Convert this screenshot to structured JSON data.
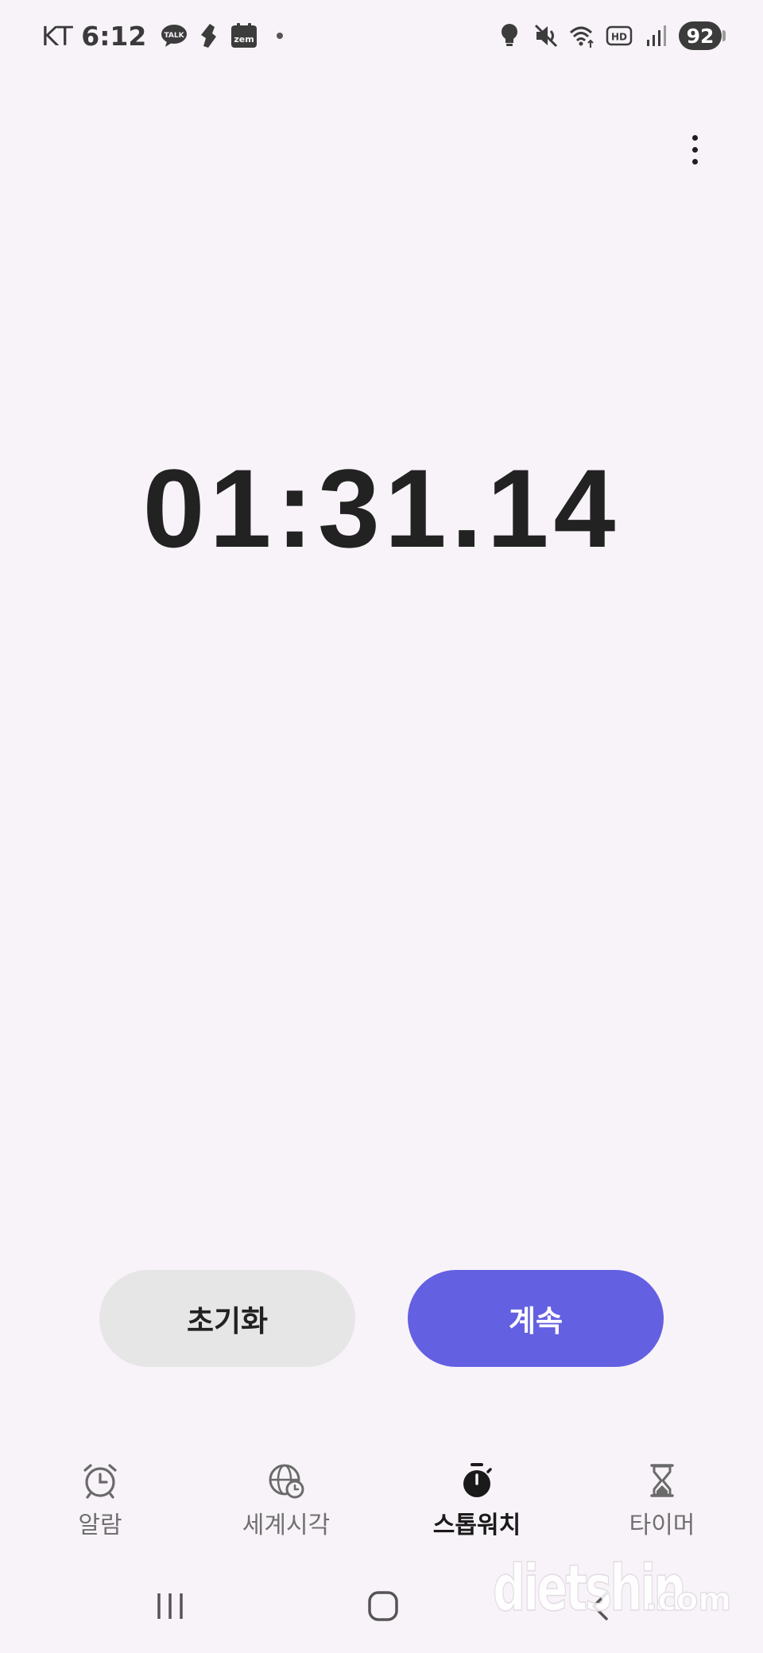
{
  "status_bar": {
    "carrier": "KT",
    "time": "6:12",
    "battery": "92",
    "notification_icons": [
      "kakaotalk-icon",
      "app-notification-icon",
      "zem-icon"
    ],
    "system_icons": [
      "bulb-icon",
      "mute-icon",
      "wifi-icon",
      "hd-voice-icon",
      "signal-icon"
    ]
  },
  "stopwatch": {
    "elapsed": "01:31.14"
  },
  "controls": {
    "reset_label": "초기화",
    "continue_label": "계속",
    "reset_color": "#e6e6e6",
    "continue_color": "#6460e2"
  },
  "tabs": [
    {
      "label": "알람",
      "icon": "alarm-clock-icon",
      "active": false
    },
    {
      "label": "세계시각",
      "icon": "globe-clock-icon",
      "active": false
    },
    {
      "label": "스톱워치",
      "icon": "stopwatch-icon",
      "active": true
    },
    {
      "label": "타이머",
      "icon": "hourglass-icon",
      "active": false
    }
  ],
  "nav_bar": {
    "recents_icon": "recents-icon",
    "home_icon": "home-icon",
    "back_icon": "back-icon"
  },
  "theme": {
    "background": "#f8f3f8",
    "accent": "#6460e2"
  }
}
